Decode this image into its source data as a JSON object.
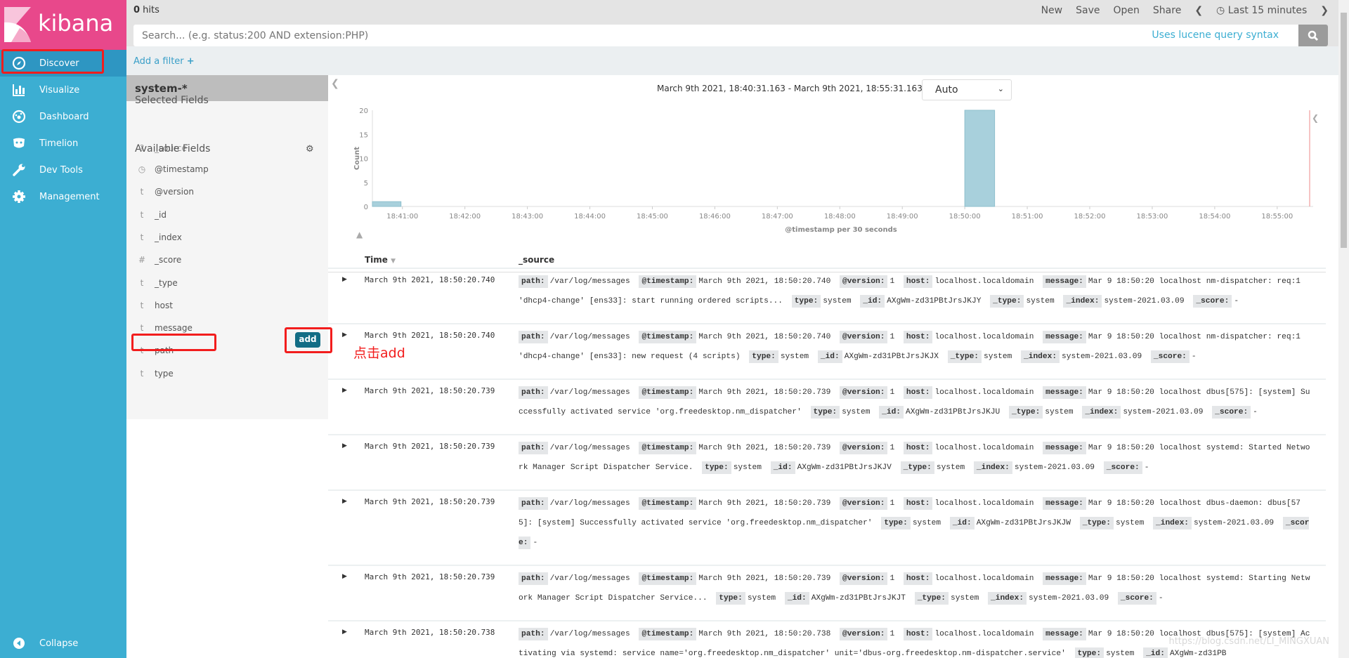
{
  "brand": "kibana",
  "colors": {
    "brand": "#e8488b",
    "sidebar": "#3caed2",
    "sidebar_active": "#2e96c2",
    "bar": "#a8d0dc",
    "add_button": "#136d85",
    "annotation": "#f21d1d"
  },
  "sidebar": {
    "items": [
      {
        "label": "Discover",
        "icon": "compass-icon",
        "active": true
      },
      {
        "label": "Visualize",
        "icon": "bar-chart-icon"
      },
      {
        "label": "Dashboard",
        "icon": "dashboard-icon"
      },
      {
        "label": "Timelion",
        "icon": "timelion-icon"
      },
      {
        "label": "Dev Tools",
        "icon": "wrench-icon"
      },
      {
        "label": "Management",
        "icon": "gear-icon"
      }
    ],
    "collapse": "Collapse"
  },
  "topbar": {
    "hits_count": "0",
    "hits_label": " hits",
    "menu": [
      "New",
      "Save",
      "Open",
      "Share"
    ],
    "time_range": "Last 15 minutes"
  },
  "search": {
    "placeholder": "Search... (e.g. status:200 AND extension:PHP)",
    "value": "",
    "syntax_link": "Uses lucene query syntax"
  },
  "filter": {
    "add_label": "Add a filter"
  },
  "fields": {
    "index_pattern": "system-*",
    "selected_title": "Selected Fields",
    "selected": [
      {
        "type": "?",
        "name": "_source"
      }
    ],
    "available_title": "Available Fields",
    "available": [
      {
        "type": "clock",
        "name": "@timestamp"
      },
      {
        "type": "t",
        "name": "@version"
      },
      {
        "type": "t",
        "name": "_id"
      },
      {
        "type": "t",
        "name": "_index"
      },
      {
        "type": "#",
        "name": "_score"
      },
      {
        "type": "t",
        "name": "_type"
      },
      {
        "type": "t",
        "name": "host"
      },
      {
        "type": "t",
        "name": "message"
      },
      {
        "type": "t",
        "name": "path"
      },
      {
        "type": "t",
        "name": "type"
      }
    ],
    "add_button": "add",
    "annotation": "点击add"
  },
  "chart_data": {
    "type": "bar",
    "range_text": "March 9th 2021, 18:40:31.163 - March 9th 2021, 18:55:31.163 —",
    "interval": "Auto",
    "xlabel": "@timestamp per 30 seconds",
    "ylabel": "Count",
    "x_domain": [
      "18:40:31.163",
      "18:55:31.163"
    ],
    "ylim": [
      0,
      20
    ],
    "yticks": [
      0,
      5,
      10,
      15,
      20
    ],
    "xticks": [
      "18:41:00",
      "18:42:00",
      "18:43:00",
      "18:44:00",
      "18:45:00",
      "18:46:00",
      "18:47:00",
      "18:48:00",
      "18:49:00",
      "18:50:00",
      "18:51:00",
      "18:52:00",
      "18:53:00",
      "18:54:00",
      "18:55:00"
    ],
    "bars": [
      {
        "x": "18:40:30",
        "value": 1
      },
      {
        "x": "18:50:00",
        "value": 20
      }
    ],
    "now_marker": "18:55:31.163"
  },
  "table": {
    "headers": [
      "Time",
      "_source"
    ],
    "rows": [
      {
        "time": "March 9th 2021, 18:50:20.740",
        "source": [
          [
            "path:",
            "/var/log/messages"
          ],
          [
            "@timestamp:",
            "March 9th 2021, 18:50:20.740"
          ],
          [
            "@version:",
            "1"
          ],
          [
            "host:",
            "localhost.localdomain"
          ],
          [
            "message:",
            "Mar 9 18:50:20 localhost nm-dispatcher: req:1 'dhcp4-change' [ens33]: start running ordered scripts..."
          ],
          [
            "type:",
            "system"
          ],
          [
            "_id:",
            "AXgWm-zd31PBtJrsJKJY"
          ],
          [
            "_type:",
            "system"
          ],
          [
            "_index:",
            "system-2021.03.09"
          ],
          [
            "_score:",
            "-"
          ]
        ]
      },
      {
        "time": "March 9th 2021, 18:50:20.740",
        "source": [
          [
            "path:",
            "/var/log/messages"
          ],
          [
            "@timestamp:",
            "March 9th 2021, 18:50:20.740"
          ],
          [
            "@version:",
            "1"
          ],
          [
            "host:",
            "localhost.localdomain"
          ],
          [
            "message:",
            "Mar 9 18:50:20 localhost nm-dispatcher: req:1 'dhcp4-change' [ens33]: new request (4 scripts)"
          ],
          [
            "type:",
            "system"
          ],
          [
            "_id:",
            "AXgWm-zd31PBtJrsJKJX"
          ],
          [
            "_type:",
            "system"
          ],
          [
            "_index:",
            "system-2021.03.09"
          ],
          [
            "_score:",
            "-"
          ]
        ]
      },
      {
        "time": "March 9th 2021, 18:50:20.739",
        "source": [
          [
            "path:",
            "/var/log/messages"
          ],
          [
            "@timestamp:",
            "March 9th 2021, 18:50:20.739"
          ],
          [
            "@version:",
            "1"
          ],
          [
            "host:",
            "localhost.localdomain"
          ],
          [
            "message:",
            "Mar 9 18:50:20 localhost dbus[575]: [system] Successfully activated service 'org.freedesktop.nm_dispatcher'"
          ],
          [
            "type:",
            "system"
          ],
          [
            "_id:",
            "AXgWm-zd31PBtJrsJKJU"
          ],
          [
            "_type:",
            "system"
          ],
          [
            "_index:",
            "system-2021.03.09"
          ],
          [
            "_score:",
            "-"
          ]
        ]
      },
      {
        "time": "March 9th 2021, 18:50:20.739",
        "source": [
          [
            "path:",
            "/var/log/messages"
          ],
          [
            "@timestamp:",
            "March 9th 2021, 18:50:20.739"
          ],
          [
            "@version:",
            "1"
          ],
          [
            "host:",
            "localhost.localdomain"
          ],
          [
            "message:",
            "Mar 9 18:50:20 localhost systemd: Started Network Manager Script Dispatcher Service."
          ],
          [
            "type:",
            "system"
          ],
          [
            "_id:",
            "AXgWm-zd31PBtJrsJKJV"
          ],
          [
            "_type:",
            "system"
          ],
          [
            "_index:",
            "system-2021.03.09"
          ],
          [
            "_score:",
            "-"
          ]
        ]
      },
      {
        "time": "March 9th 2021, 18:50:20.739",
        "source": [
          [
            "path:",
            "/var/log/messages"
          ],
          [
            "@timestamp:",
            "March 9th 2021, 18:50:20.739"
          ],
          [
            "@version:",
            "1"
          ],
          [
            "host:",
            "localhost.localdomain"
          ],
          [
            "message:",
            "Mar 9 18:50:20 localhost dbus-daemon: dbus[575]: [system] Successfully activated service 'org.freedesktop.nm_dispatcher'"
          ],
          [
            "type:",
            "system"
          ],
          [
            "_id:",
            "AXgWm-zd31PBtJrsJKJW"
          ],
          [
            "_type:",
            "system"
          ],
          [
            "_index:",
            "system-2021.03.09"
          ],
          [
            "_score:",
            "-"
          ]
        ]
      },
      {
        "time": "March 9th 2021, 18:50:20.739",
        "source": [
          [
            "path:",
            "/var/log/messages"
          ],
          [
            "@timestamp:",
            "March 9th 2021, 18:50:20.739"
          ],
          [
            "@version:",
            "1"
          ],
          [
            "host:",
            "localhost.localdomain"
          ],
          [
            "message:",
            "Mar 9 18:50:20 localhost systemd: Starting Network Manager Script Dispatcher Service..."
          ],
          [
            "type:",
            "system"
          ],
          [
            "_id:",
            "AXgWm-zd31PBtJrsJKJT"
          ],
          [
            "_type:",
            "system"
          ],
          [
            "_index:",
            "system-2021.03.09"
          ],
          [
            "_score:",
            "-"
          ]
        ]
      },
      {
        "time": "March 9th 2021, 18:50:20.738",
        "source": [
          [
            "path:",
            "/var/log/messages"
          ],
          [
            "@timestamp:",
            "March 9th 2021, 18:50:20.738"
          ],
          [
            "@version:",
            "1"
          ],
          [
            "host:",
            "localhost.localdomain"
          ],
          [
            "message:",
            "Mar 9 18:50:20 localhost dbus[575]: [system] Activating via systemd: service name='org.freedesktop.nm_dispatcher' unit='dbus-org.freedesktop.nm-dispatcher.service'"
          ],
          [
            "type:",
            "system"
          ],
          [
            "_id:",
            "AXgWm-zd31PB"
          ]
        ]
      }
    ]
  },
  "watermark": "https://blog.csdn.net/LI_MINGXUAN"
}
